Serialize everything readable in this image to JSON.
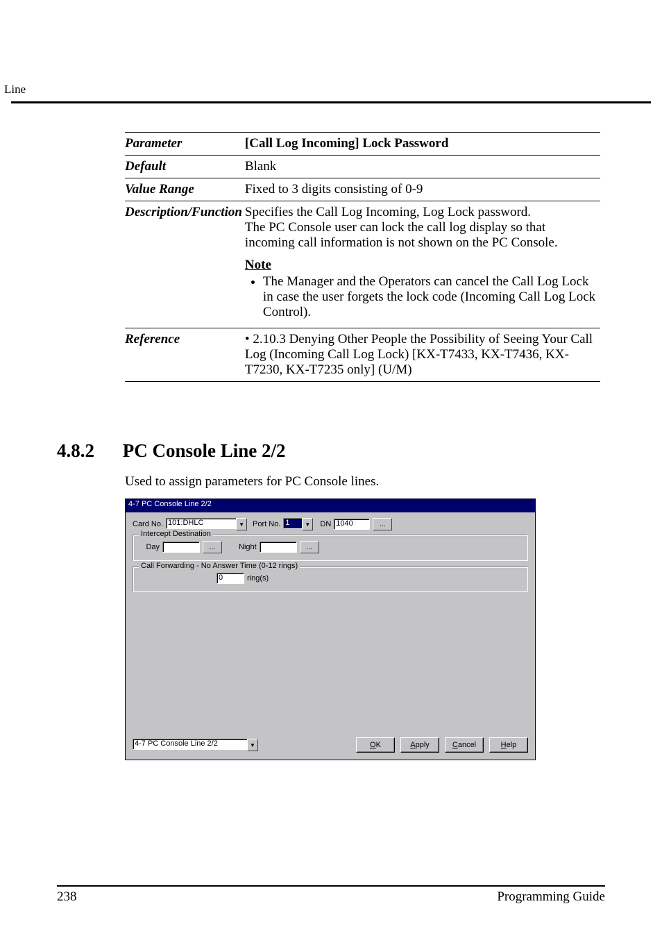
{
  "header": {
    "section": "Line"
  },
  "param_table": {
    "parameter_label": "Parameter",
    "parameter_value": "[Call Log Incoming] Lock Password",
    "default_label": "Default",
    "default_value": "Blank",
    "range_label": "Value Range",
    "range_value": "Fixed to 3 digits consisting of 0-9",
    "desc_label": "Description/Function",
    "desc_value": "Specifies the Call Log Incoming, Log Lock password.\nThe PC Console user can lock the call log display so that incoming call information is not shown on the PC Console.",
    "note_label": "Note",
    "note_item": "The Manager and the Operators can cancel the Call Log Lock in case the user forgets the lock code (Incoming Call Log Lock Control).",
    "ref_label": "Reference",
    "ref_value": "• 2.10.3 Denying Other People the Possibility of Seeing Your Call Log (Incoming Call Log Lock) [KX-T7433, KX-T7436, KX-T7230, KX-T7235 only] (U/M)"
  },
  "section": {
    "number": "4.8.2",
    "title": "PC Console Line 2/2",
    "intro": "Used to assign parameters for PC Console lines."
  },
  "mock": {
    "title": "4-7 PC Console Line 2/2",
    "cardno_label": "Card No.",
    "cardno_value": "101:DHLC",
    "portno_label": "Port No.",
    "portno_value": "1",
    "dn_label": "DN",
    "dn_value": "1040",
    "dn_btn": "...",
    "intercept_legend": "Intercept Destination",
    "day_label": "Day",
    "day_value": "",
    "day_btn": "...",
    "night_label": "Night",
    "night_value": "",
    "night_btn": "...",
    "cf_legend": "Call Forwarding - No Answer Time (0-12 rings)",
    "cf_value": "0",
    "cf_unit": "ring(s)",
    "nav_value": "4-7 PC Console Line 2/2",
    "ok": "OK",
    "apply": "Apply",
    "cancel": "Cancel",
    "help": "Help"
  },
  "footer": {
    "page": "238",
    "book": "Programming Guide"
  }
}
